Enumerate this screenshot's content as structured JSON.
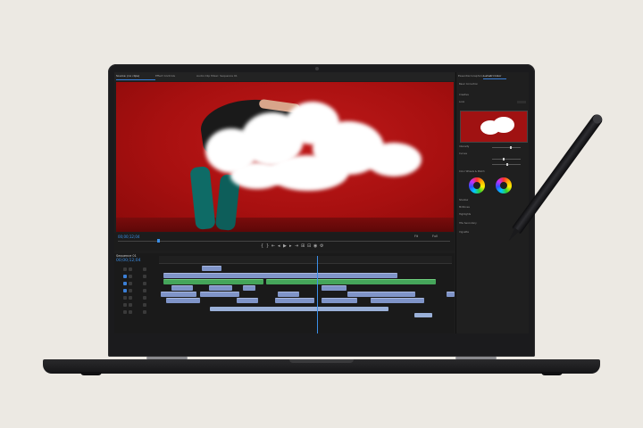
{
  "monitor": {
    "tabs": [
      "Source: (no clips)",
      "Effect Controls",
      "Audio Clip Mixer: Sequence 01"
    ],
    "timecode": "00;00;12;04",
    "fit_label": "Fit",
    "full_label": "Full"
  },
  "timeline": {
    "sequence_tab": "Sequence 01",
    "timecode": "00;00;12;04"
  },
  "panel": {
    "tabs": [
      "Essential Graphics",
      "Lumetri Color"
    ],
    "rows": [
      "Basic Correction",
      "Creative",
      "Look",
      "Intensity",
      "Curves",
      "Color Wheels & Match",
      "Shadow",
      "Midtones",
      "Highlights",
      "HSL Secondary",
      "Vignette"
    ]
  },
  "colors": {
    "accent": "#3b8fe8",
    "video_red": "#a81010",
    "clip_blue": "#7f94c8",
    "clip_green": "#45a55a"
  }
}
